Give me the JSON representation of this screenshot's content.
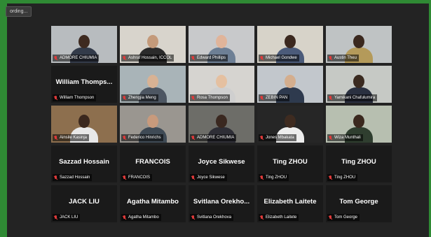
{
  "recording": {
    "label": "ording..."
  },
  "participants": [
    {
      "name": "ADMORE CHIUMIA",
      "video": true,
      "bg": "#b8bcbf",
      "skin": "#3e2a20",
      "shirt": "#333b4a"
    },
    {
      "name": "Ashraf Hossain, ICCOL",
      "video": true,
      "active": true,
      "bg": "#d8d4cc",
      "skin": "#c49a7a",
      "shirt": "#2b2b2b"
    },
    {
      "name": "Edward Phillips",
      "video": true,
      "bg": "#c8c9cb",
      "skin": "#e0b49a",
      "shirt": "#6d7f95"
    },
    {
      "name": "Michael Gondwe",
      "video": true,
      "bg": "#d7d3c9",
      "skin": "#3b281e",
      "shirt": "#4b5b7a"
    },
    {
      "name": "Austin Theu",
      "video": true,
      "bg": "#bfc3c4",
      "skin": "#3a281e",
      "shirt": "#b49a5a"
    },
    {
      "name": "William Thompson",
      "video": false,
      "big": "William  Thomps..."
    },
    {
      "name": "Zhengjia Meng",
      "video": true,
      "bg": "#a9b4b8",
      "skin": "#d8b294",
      "shirt": "#4d5662"
    },
    {
      "name": "Rosa Thompson",
      "video": true,
      "bg": "#d6d4d0",
      "skin": "#e5c0a0",
      "shirt": "#cfcfcf"
    },
    {
      "name": "ZEBIN PAN",
      "video": true,
      "bg": "#c2c7cc",
      "skin": "#d4ae8e",
      "shirt": "#2e3a4e"
    },
    {
      "name": "Yamikani Chafulumira",
      "video": true,
      "bg": "#c6c9c5",
      "skin": "#3a2a20",
      "shirt": "#2a3040"
    },
    {
      "name": "Ainsile Kasinja",
      "video": true,
      "bg": "#8d6f4e",
      "skin": "#3b281e",
      "shirt": "#e8e8e8"
    },
    {
      "name": "Federico Hinrichs",
      "video": true,
      "bg": "#9a9690",
      "skin": "#c89a7c",
      "shirt": "#3f4a55"
    },
    {
      "name": "ADMORE CHIUMIA",
      "video": true,
      "bg": "#6d6d68",
      "skin": "#3a2820",
      "shirt": "#2e2e36"
    },
    {
      "name": "Jones Mbakata",
      "video": true,
      "bg": "#262626",
      "skin": "#3e2b20",
      "shirt": "#ededed"
    },
    {
      "name": "Wiza Munthali",
      "video": true,
      "bg": "#b7bfb0",
      "skin": "#3a281e",
      "shirt": "#2f3e2f"
    },
    {
      "name": "Sazzad Hossain",
      "video": false,
      "big": "Sazzad Hossain"
    },
    {
      "name": "FRANCOIS",
      "video": false,
      "big": "FRANCOIS"
    },
    {
      "name": "Joyce Sikwese",
      "video": false,
      "big": "Joyce Sikwese"
    },
    {
      "name": "Ting ZHOU",
      "video": false,
      "big": "Ting ZHOU"
    },
    {
      "name": "Ting ZHOU",
      "video": false,
      "big": "Ting ZHOU"
    },
    {
      "name": "JACK LIU",
      "video": false,
      "big": "JACK LIU"
    },
    {
      "name": "Agatha Mitambo",
      "video": false,
      "big": "Agatha Mitambo"
    },
    {
      "name": "Svitlana Orekhova",
      "video": false,
      "big": "Svitlana  Orekho..."
    },
    {
      "name": "Elizabeth Laitete",
      "video": false,
      "big": "Elizabeth Laitete"
    },
    {
      "name": "Tom George",
      "video": false,
      "big": "Tom George"
    }
  ],
  "colors": {
    "active_border": "#b6e24a",
    "muted_mic": "#e03a3a",
    "frame": "#2f8a34"
  }
}
